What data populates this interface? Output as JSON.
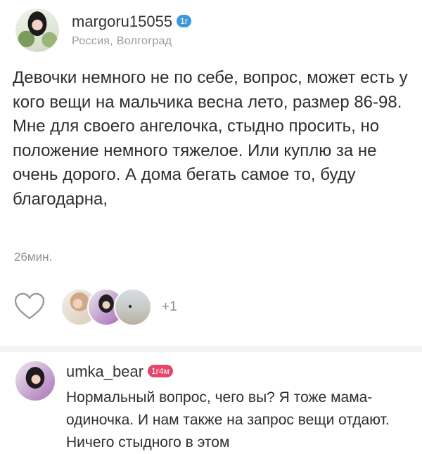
{
  "post": {
    "author": {
      "username": "margoru15055",
      "badge": "1г",
      "location": "Россия, Волгоград"
    },
    "text": "Девочки немного не по себе, вопрос, может есть у кого вещи на мальчика весна лето, размер 86-98. Мне для своего ангелочка, стыдно просить, но положение немного тяжелое. Или куплю за не очень дорого. А дома бегать самое то, буду благодарна,",
    "time": "26мин.",
    "likes": {
      "icon": "heart-outline-icon",
      "extra_count": "+1"
    }
  },
  "comment": {
    "username": "umka_bear",
    "badge": "1г4м",
    "text": "Нормальный вопрос, чего вы? Я тоже мама-одиночка. И нам также на запрос вещи отдают. Ничего стыдного в этом"
  },
  "colors": {
    "badge_blue": "#3d9ad8",
    "badge_pink": "#e8456b",
    "muted_text": "#9a9a9a",
    "divider": "#f3f3f3"
  }
}
